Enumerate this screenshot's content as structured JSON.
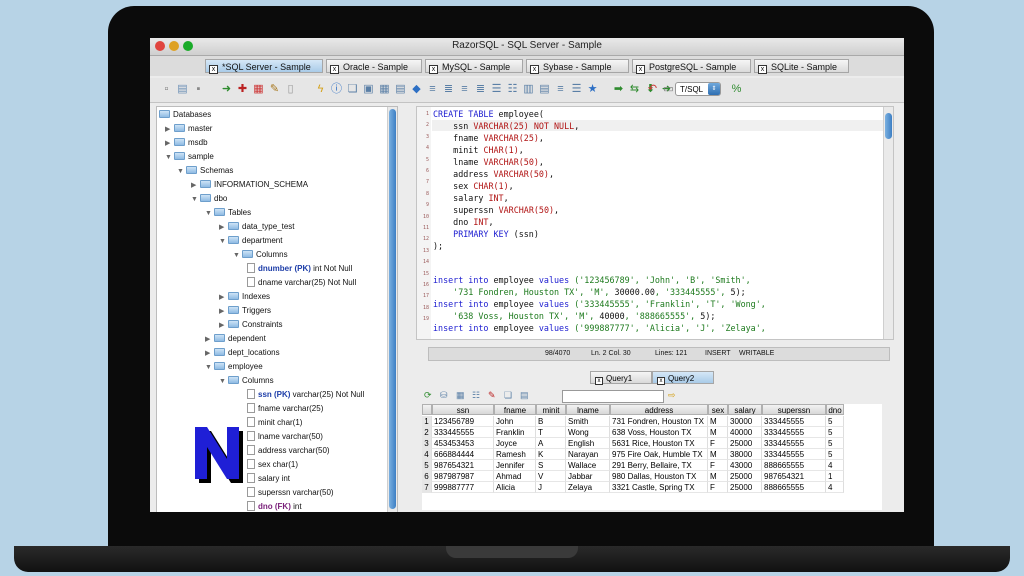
{
  "window": {
    "title": "RazorSQL - SQL Server - Sample"
  },
  "tabs": [
    {
      "label": "*SQL Server - Sample"
    },
    {
      "label": "Oracle - Sample"
    },
    {
      "label": "MySQL - Sample"
    },
    {
      "label": "Sybase - Sample"
    },
    {
      "label": "PostgreSQL - Sample"
    },
    {
      "label": "SQLite - Sample"
    }
  ],
  "toolbar": {
    "dialect": "T/SQL"
  },
  "tree": {
    "root": "Databases",
    "items": [
      {
        "label": "master"
      },
      {
        "label": "msdb"
      },
      {
        "label": "sample"
      },
      {
        "label": "Schemas"
      },
      {
        "label": "INFORMATION_SCHEMA"
      },
      {
        "label": "dbo"
      },
      {
        "label": "Tables"
      },
      {
        "label": "data_type_test"
      },
      {
        "label": "department"
      },
      {
        "label": "Columns"
      },
      {
        "label": "dnumber (PK)",
        "suffix": " int Not Null"
      },
      {
        "label": "dname varchar(25) Not Null"
      },
      {
        "label": "Indexes"
      },
      {
        "label": "Triggers"
      },
      {
        "label": "Constraints"
      },
      {
        "label": "dependent"
      },
      {
        "label": "dept_locations"
      },
      {
        "label": "employee"
      },
      {
        "label": "Columns"
      },
      {
        "label": "ssn (PK)",
        "suffix": " varchar(25) Not Null"
      },
      {
        "label": "fname varchar(25)"
      },
      {
        "label": "minit char(1)"
      },
      {
        "label": "lname varchar(50)"
      },
      {
        "label": "address varchar(50)"
      },
      {
        "label": "sex char(1)"
      },
      {
        "label": "salary int"
      },
      {
        "label": "superssn varchar(50)"
      },
      {
        "label": "dno (FK)",
        "suffix": " int"
      }
    ]
  },
  "editor": {
    "line_numbers": [
      "1",
      "2",
      "3",
      "4",
      "5",
      "6",
      "7",
      "8",
      "9",
      "10",
      "11",
      "12",
      "13",
      "14",
      "15",
      "16",
      "17",
      "18",
      "19"
    ],
    "l1": {
      "kw": "CREATE TABLE",
      "rest": " employee("
    },
    "l2": {
      "name": "ssn ",
      "type": "VARCHAR(25) NOT NULL",
      "tail": ","
    },
    "l3": {
      "name": "fname ",
      "type": "VARCHAR(25)",
      "tail": ","
    },
    "l4": {
      "name": "minit ",
      "type": "CHAR(1)",
      "tail": ","
    },
    "l5": {
      "name": "lname ",
      "type": "VARCHAR(50)",
      "tail": ","
    },
    "l6": {
      "name": "address ",
      "type": "VARCHAR(50)",
      "tail": ","
    },
    "l7": {
      "name": "sex ",
      "type": "CHAR(1)",
      "tail": ","
    },
    "l8": {
      "name": "salary ",
      "type": "INT",
      "tail": ","
    },
    "l9": {
      "name": "superssn ",
      "type": "VARCHAR(50)",
      "tail": ","
    },
    "l10": {
      "name": "dno ",
      "type": "INT",
      "tail": ","
    },
    "l11": {
      "kw": "PRIMARY KEY",
      "rest": " (ssn)"
    },
    "l12": {
      "text": ");"
    },
    "l15": {
      "kw": "insert into",
      "rest": " employee ",
      "kw2": "values",
      "str": " ('123456789', 'John', 'B', 'Smith',"
    },
    "l16": {
      "str": "'731 Fondren, Houston TX', 'M', ",
      "num": "30000.00",
      "str2": ", '333445555', ",
      "num2": "5",
      "end": ");"
    },
    "l17": {
      "kw": "insert into",
      "rest": " employee ",
      "kw2": "values",
      "str": " ('333445555', 'Franklin', 'T', 'Wong',"
    },
    "l18": {
      "str": "'638 Voss, Houston TX', 'M', ",
      "num": "40000",
      "str2": ", '888665555', ",
      "num2": "5",
      "end": ");"
    },
    "l19": {
      "kw": "insert into",
      "rest": " employee ",
      "kw2": "values",
      "str": " ('999887777', 'Alicia', 'J', 'Zelaya',"
    }
  },
  "status": {
    "position": "98/4070",
    "cursor": "Ln. 2 Col. 30",
    "lines": "Lines: 121",
    "mode": "INSERT",
    "state": "WRITABLE"
  },
  "query_tabs": [
    {
      "label": "Query1"
    },
    {
      "label": "Query2"
    }
  ],
  "results": {
    "columns": [
      "ssn",
      "fname",
      "minit",
      "lname",
      "address",
      "sex",
      "salary",
      "superssn",
      "dno"
    ],
    "rows": [
      [
        "1",
        "123456789",
        "John",
        "B",
        "Smith",
        "731 Fondren, Houston TX",
        "M",
        "30000",
        "333445555",
        "5"
      ],
      [
        "2",
        "333445555",
        "Franklin",
        "T",
        "Wong",
        "638 Voss, Houston TX",
        "M",
        "40000",
        "333445555",
        "5"
      ],
      [
        "3",
        "453453453",
        "Joyce",
        "A",
        "English",
        "5631 Rice, Houston TX",
        "F",
        "25000",
        "333445555",
        "5"
      ],
      [
        "4",
        "666884444",
        "Ramesh",
        "K",
        "Narayan",
        "975 Fire Oak, Humble TX",
        "M",
        "38000",
        "333445555",
        "5"
      ],
      [
        "5",
        "987654321",
        "Jennifer",
        "S",
        "Wallace",
        "291 Berry, Bellaire, TX",
        "F",
        "43000",
        "888665555",
        "4"
      ],
      [
        "6",
        "987987987",
        "Ahmad",
        "V",
        "Jabbar",
        "980 Dallas, Houston TX",
        "M",
        "25000",
        "987654321",
        "1"
      ],
      [
        "7",
        "999887777",
        "Alicia",
        "J",
        "Zelaya",
        "3321 Castle, Spring TX",
        "F",
        "25000",
        "888665555",
        "4"
      ]
    ]
  },
  "logo": {
    "letter": "N",
    "fill": "#1f1fd6"
  }
}
